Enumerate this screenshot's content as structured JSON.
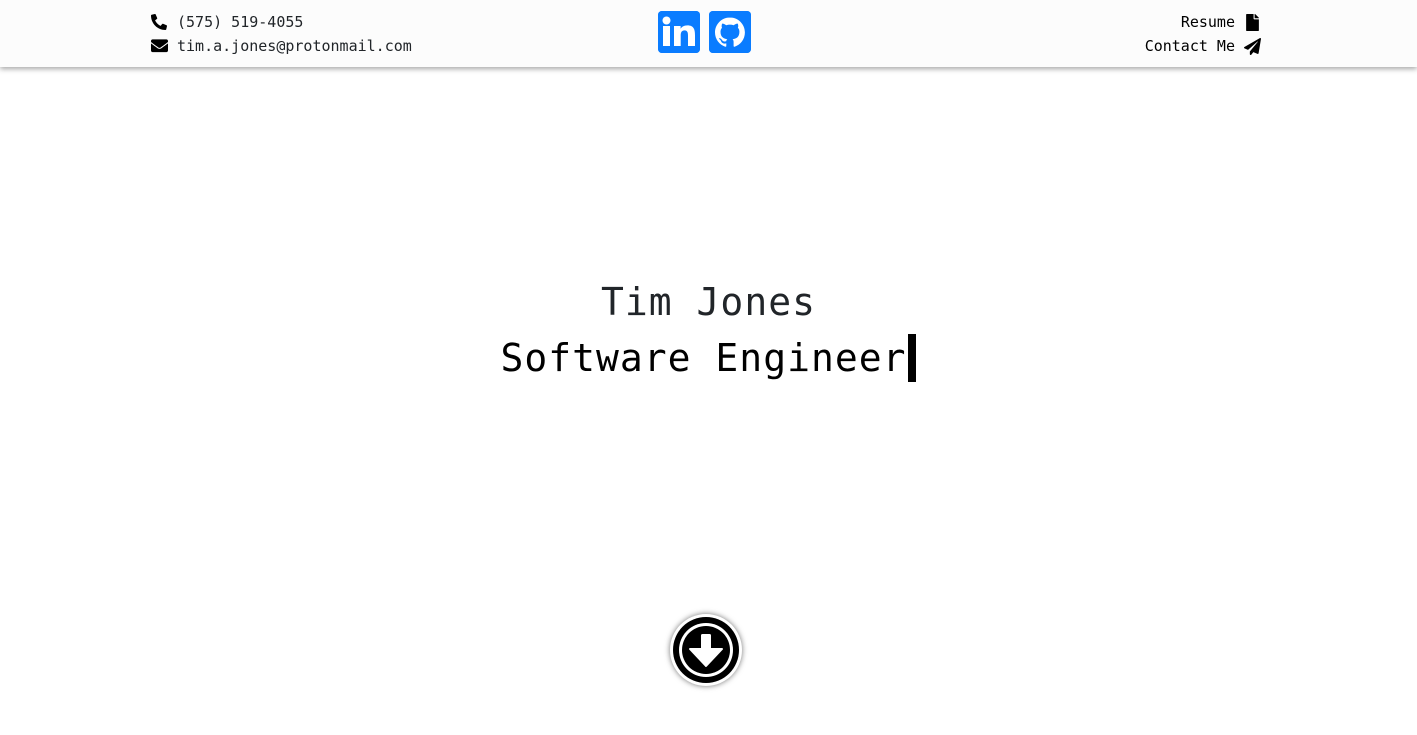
{
  "header": {
    "contact": {
      "phone": {
        "icon": "phone-icon",
        "text": "(575) 519-4055"
      },
      "email": {
        "icon": "envelope-icon",
        "text": "tim.a.jones@protonmail.com"
      }
    },
    "social": [
      {
        "icon": "linkedin-icon",
        "label": "LinkedIn"
      },
      {
        "icon": "github-icon",
        "label": "GitHub"
      }
    ],
    "nav": {
      "resume": {
        "label": "Resume",
        "icon": "file-icon"
      },
      "contact": {
        "label": "Contact Me",
        "icon": "paper-plane-icon"
      }
    }
  },
  "hero": {
    "name": "Tim Jones",
    "title": "Software Engineer"
  },
  "scroll_button": {
    "icon": "arrow-circle-down-icon"
  },
  "colors": {
    "accent": "#0a7cff",
    "header_bg": "#fcfcfc",
    "text": "#212529"
  }
}
